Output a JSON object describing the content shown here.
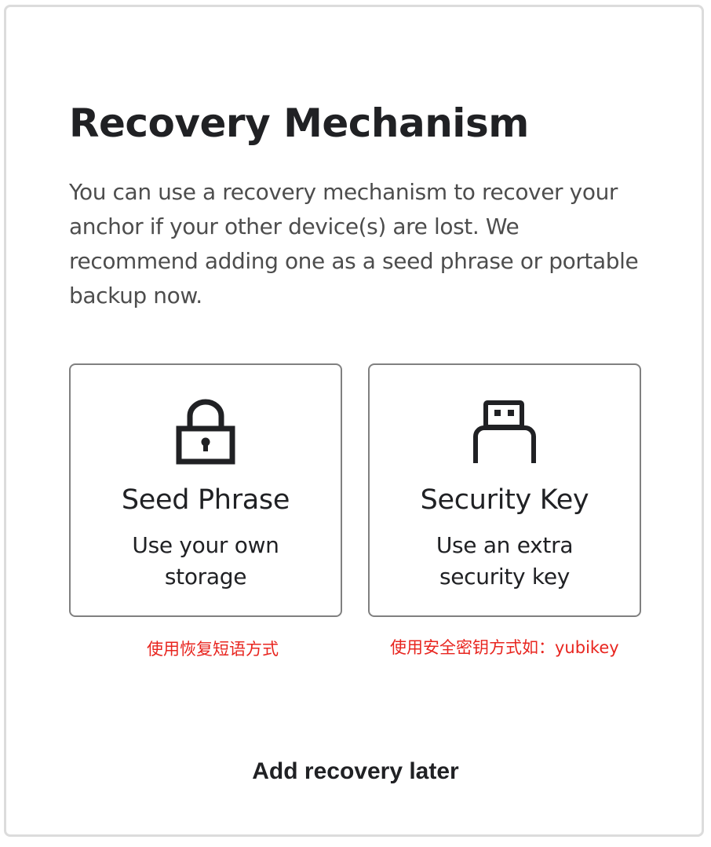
{
  "page": {
    "title": "Recovery Mechanism",
    "description": "You can use a recovery mechanism to recover your anchor if your other device(s) are lost. We recommend adding one as a seed phrase or portable backup now."
  },
  "options": [
    {
      "icon": "lock-icon",
      "title": "Seed Phrase",
      "subtitle": "Use your own storage",
      "annotation": "使用恢复短语方式"
    },
    {
      "icon": "usb-key-icon",
      "title": "Security Key",
      "subtitle": "Use an extra security key",
      "annotation": "使用安全密钥方式如：yubikey"
    }
  ],
  "actions": {
    "later_label": "Add recovery later"
  },
  "colors": {
    "text": "#202124",
    "muted": "#4d4d4d",
    "card_border": "#808080",
    "annotation": "#e8251f",
    "frame_border": "#dcdcdc"
  }
}
